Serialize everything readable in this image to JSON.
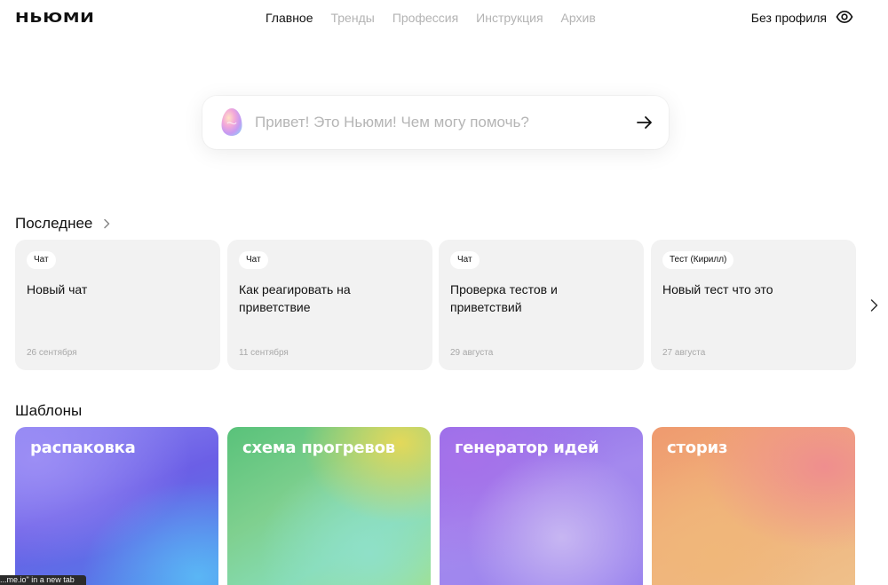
{
  "header": {
    "logo": "НЬЮМИ",
    "nav": [
      "Главное",
      "Тренды",
      "Профессия",
      "Инструкция",
      "Архив"
    ],
    "profile": "Без профиля"
  },
  "search": {
    "placeholder": "Привет! Это Ньюми! Чем могу помочь?"
  },
  "recent": {
    "title": "Последнее",
    "cards": [
      {
        "badge": "Чат",
        "title": "Новый чат",
        "date": "26 сентября"
      },
      {
        "badge": "Чат",
        "title": "Как реагировать на приветствие",
        "date": "11 сентября"
      },
      {
        "badge": "Чат",
        "title": "Проверка тестов и приветствий",
        "date": "29 августа"
      },
      {
        "badge": "Тест (Кирилл)",
        "title": "Новый тест что это",
        "date": "27 августа"
      }
    ]
  },
  "templates": {
    "title": "Шаблоны",
    "items": [
      "распаковка",
      "схема прогревов",
      "генератор идей",
      "сториз"
    ]
  },
  "status_bar": "...me.io\" in a new tab",
  "colors": {
    "card_bg": "#f2f2f2",
    "nav_inactive": "#b3b3b3",
    "text": "#111111"
  }
}
